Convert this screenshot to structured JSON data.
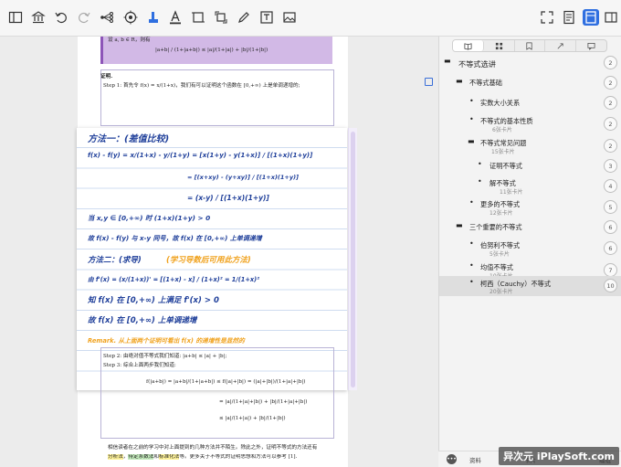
{
  "toolbar": {
    "items": [
      "sidebar-icon",
      "library-icon",
      "undo-icon",
      "redo-icon",
      "mindmap-icon",
      "target-icon",
      "highlighter-icon",
      "text-color-icon",
      "crop-icon",
      "rotate-icon",
      "pen-icon",
      "textbox-icon",
      "image-icon",
      "fullscreen-icon",
      "notes-icon",
      "panel-icon",
      "more-icon"
    ],
    "active": "panel-icon",
    "accent": "#2f6fe0"
  },
  "document": {
    "pdf_top_theorem": "设 a, b ∈ R，则有",
    "pdf_top_formula": "|a+b| / (1+|a+b|) ≤ |a|/(1+|a|) + |b|/(1+|b|)",
    "pdf_proof_title": "证明.",
    "pdf_step1": "Step 1: 首先令 f(x) = x/(1+x)，我们有可以证明这个函数在 [0,+∞) 上是单调递增的;",
    "handwritten": [
      {
        "text": "方法一：(差值比较)",
        "color": "#1f3f9a"
      },
      {
        "text": "f(x) - f(y) = x/(1+x) - y/(1+y) = [x(1+y) - y(1+x)] / [(1+x)(1+y)]",
        "color": "#1f3f9a"
      },
      {
        "text": "= [(x+xy) - (y+xy)] / [(1+x)(1+y)]",
        "color": "#1f3f9a"
      },
      {
        "text": "= (x-y) / [(1+x)(1+y)]",
        "color": "#1f3f9a"
      },
      {
        "text": "当 x,y ∈ [0,+∞) 时 (1+x)(1+y) > 0",
        "color": "#1f3f9a"
      },
      {
        "text": "故 f(x) - f(y) 与 x-y 同号，故 f(x) 在 [0,+∞) 上单调递增",
        "color": "#1f3f9a"
      },
      {
        "text": "方法二：(求导)",
        "color": "#1f3f9a"
      },
      {
        "text": "(学习导数后可用此方法)",
        "color": "#f0a21e"
      },
      {
        "text": "由 f'(x) = (x/(1+x))' = [(1+x) - x] / (1+x)² = 1/(1+x)²",
        "color": "#1f3f9a"
      },
      {
        "text": "知 f(x) 在 [0,+∞) 上满足 f'(x) > 0",
        "color": "#1f3f9a"
      },
      {
        "text": "故 f(x) 在 [0,+∞) 上单调递增",
        "color": "#1f3f9a"
      },
      {
        "text": "Remark. 从上面两个证明可看出 f(x) 的递增性是显然的",
        "color": "#f0a21e"
      }
    ],
    "pdf_step2": "Step 2: 由绝对值不等式我们知道: |a+b| ≤ |a| + |b|;",
    "pdf_step3": "Step 3: 综合上面两步我们知道:",
    "pdf_eq1": "f(|a+b|) = |a+b|/(1+|a+b|) ≤ f(|a|+|b|) = (|a|+|b|)/(1+|a|+|b|)",
    "pdf_eq2": "= |a|/(1+|a|+|b|) + |b|/(1+|a|+|b|)",
    "pdf_eq3": "≤ |a|/(1+|a|) + |b|/(1+|b|)",
    "pdf_para_a": "相信读者在之前的学习中对上面提到的几种方法并不陌生。除此之外，证明不等式的方法还有",
    "pdf_para_b_pre": "",
    "pdf_para_b_hl1": "分析法",
    "pdf_para_b_mid": "，",
    "pdf_para_b_hl2": "待定系数法",
    "pdf_para_b_mid2": "和",
    "pdf_para_b_hl3": "标准化法",
    "pdf_para_b_post": "等。更多关于不等式的证明思想和方法可以参考 [1]."
  },
  "sidebar": {
    "tabs": [
      "book-icon",
      "grid-icon",
      "bookmark-icon",
      "link-icon",
      "comment-icon"
    ],
    "active_tab": "book-icon",
    "items": [
      {
        "title": "不等式选讲",
        "sub": "",
        "num": "2",
        "bullet": "▬"
      },
      {
        "title": "不等式基础",
        "sub": "",
        "num": "2",
        "bullet": "▬"
      },
      {
        "title": "实数大小关系",
        "sub": "",
        "num": "2",
        "bullet": "•"
      },
      {
        "title": "不等式的基本性质",
        "sub": "6张卡片",
        "num": "2",
        "bullet": "•"
      },
      {
        "title": "不等式常见问题",
        "sub": "15张卡片",
        "num": "2",
        "bullet": "▬"
      },
      {
        "title": "证明不等式",
        "sub": "",
        "num": "3",
        "bullet": "•"
      },
      {
        "title": "解不等式",
        "sub": "11张卡片",
        "num": "4",
        "bullet": "•"
      },
      {
        "title": "更多的不等式",
        "sub": "12张卡片",
        "num": "5",
        "bullet": "•"
      },
      {
        "title": "三个重要的不等式",
        "sub": "",
        "num": "6",
        "bullet": "▬"
      },
      {
        "title": "伯努利不等式",
        "sub": "5张卡片",
        "num": "6",
        "bullet": "•"
      },
      {
        "title": "均值不等式",
        "sub": "10张卡片",
        "num": "7",
        "bullet": "•"
      },
      {
        "title": "柯西（Cauchy）不等式",
        "sub": "20张卡片",
        "num": "10",
        "bullet": "•"
      }
    ],
    "selected_index": 11
  },
  "bottom_bar": {
    "dots": "•••",
    "tab1": "资料",
    "tab2": "卡片",
    "tab3": "编组"
  },
  "watermark": "异次元 iPlaySoft.com"
}
